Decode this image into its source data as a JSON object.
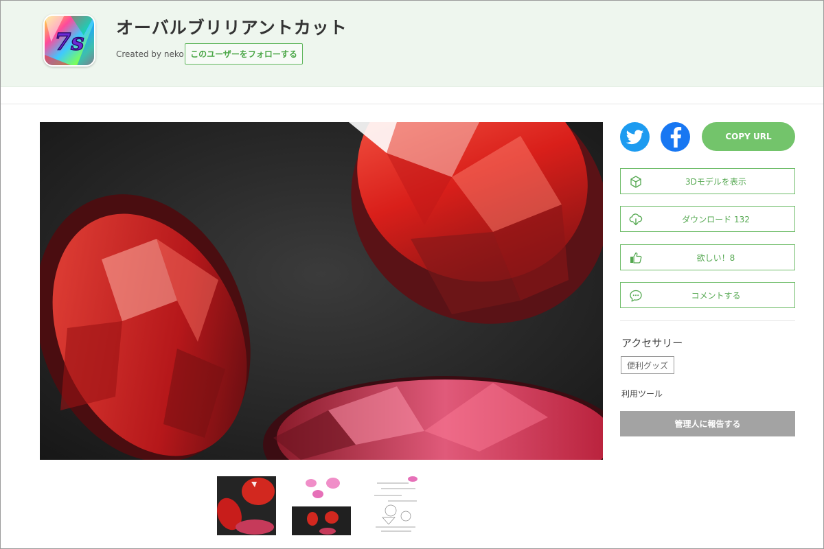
{
  "header": {
    "title": "オーバルブリリアントカット",
    "created_by_prefix": "Created by",
    "creator_name": "neko",
    "follow_label": "このユーザーをフォローする",
    "avatar_text": "7s"
  },
  "share": {
    "twitter_icon": "twitter-bird-icon",
    "facebook_icon": "facebook-f-icon",
    "copy_url_label": "COPY URL"
  },
  "actions": [
    {
      "label": "3Dモデルを表示",
      "icon": "cube-icon"
    },
    {
      "label": "ダウンロード 132",
      "icon": "cloud-download-icon"
    },
    {
      "label": "欲しい！8",
      "icon": "thumbs-up-icon"
    },
    {
      "label": "コメントする",
      "icon": "speech-bubble-icon"
    }
  ],
  "category": {
    "title": "アクセサリー",
    "tag": "便利グッズ",
    "tool_label": "利用ツール"
  },
  "report_label": "管理人に報告する",
  "colors": {
    "accent_green": "#73c46b",
    "header_bg": "#eef6ee",
    "twitter_blue": "#1d9bf0",
    "facebook_blue": "#1877f2",
    "report_gray": "#a3a3a3"
  }
}
